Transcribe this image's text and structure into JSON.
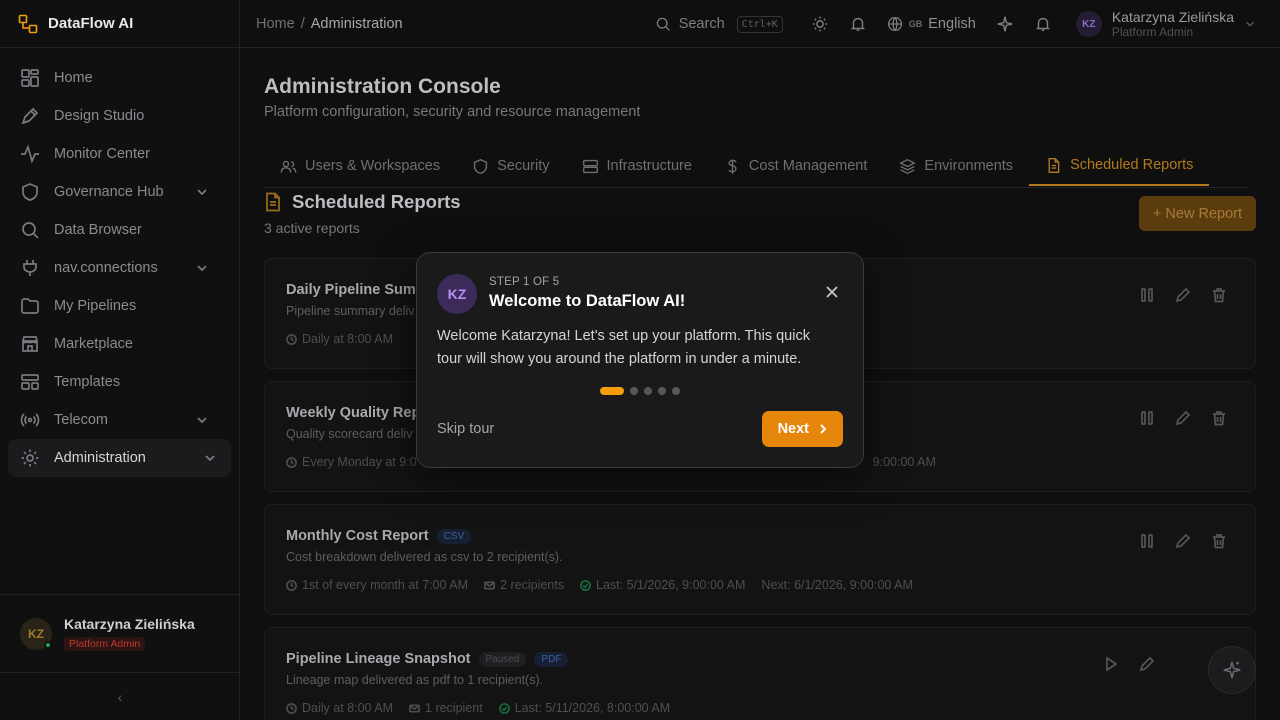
{
  "brand": {
    "name": "DataFlow AI"
  },
  "sidebar": {
    "items": [
      {
        "label": "Home",
        "icon": "grid-icon"
      },
      {
        "label": "Design Studio",
        "icon": "pen-icon"
      },
      {
        "label": "Monitor Center",
        "icon": "activity-icon"
      },
      {
        "label": "Governance Hub",
        "icon": "shield-icon"
      },
      {
        "label": "Data Browser",
        "icon": "search-icon"
      },
      {
        "label": "nav.connections",
        "icon": "plug-icon"
      },
      {
        "label": "My Pipelines",
        "icon": "folder-icon"
      },
      {
        "label": "Marketplace",
        "icon": "store-icon"
      },
      {
        "label": "Templates",
        "icon": "template-icon"
      },
      {
        "label": "Telecom",
        "icon": "radio-icon"
      },
      {
        "label": "Administration",
        "icon": "gear-icon"
      }
    ],
    "user": {
      "name": "Katarzyna Zielińska",
      "role": "Platform Admin",
      "initials": "KZ"
    },
    "collapse_glyph": "‹"
  },
  "topbar": {
    "breadcrumb": {
      "home": "Home",
      "sep": "/",
      "current": "Administration"
    },
    "search_label": "Search",
    "search_shortcut": "Ctrl+K",
    "lang_code": "GB",
    "language": "English",
    "user": {
      "name": "Katarzyna Zielińska",
      "role": "Platform Admin",
      "initials": "KZ"
    }
  },
  "page": {
    "title": "Administration Console",
    "subtitle": "Platform configuration, security and resource management",
    "tabs": [
      {
        "label": "Users & Workspaces"
      },
      {
        "label": "Security"
      },
      {
        "label": "Infrastructure"
      },
      {
        "label": "Cost Management"
      },
      {
        "label": "Environments"
      },
      {
        "label": "Scheduled Reports"
      }
    ]
  },
  "reports": {
    "title": "Scheduled Reports",
    "count_text": "3 active reports",
    "new_button": "+ New Report",
    "cards": [
      {
        "title": "Daily Pipeline Summ",
        "desc": "Pipeline summary deliv",
        "schedule": "Daily at 8:00 AM",
        "recipients": "",
        "last": "",
        "next": "M"
      },
      {
        "title": "Weekly Quality Rep",
        "desc": "Quality scorecard deliv",
        "schedule": "Every Monday at 9:0",
        "recipients": "",
        "last": "",
        "next": "9:00:00 AM"
      },
      {
        "title": "Monthly Cost Report",
        "badge": "CSV",
        "desc": "Cost breakdown delivered as csv to 2 recipient(s).",
        "schedule": "1st of every month at 7:00 AM",
        "recipients": "2 recipients",
        "last": "Last: 5/1/2026, 9:00:00 AM",
        "next": "Next: 6/1/2026, 9:00:00 AM"
      },
      {
        "title": "Pipeline Lineage Snapshot",
        "badge_status": "Paused",
        "badge": "PDF",
        "desc": "Lineage map delivered as pdf to 1 recipient(s).",
        "schedule": "Daily at 8:00 AM",
        "recipients": "1 recipient",
        "last": "Last: 5/11/2026, 8:00:00 AM"
      }
    ]
  },
  "tour": {
    "initials": "KZ",
    "step": "STEP 1 OF 5",
    "title": "Welcome to DataFlow AI!",
    "body": "Welcome Katarzyna! Let's set up your platform. This quick tour will show you around the platform in under a minute.",
    "current_step": 1,
    "total_steps": 5,
    "skip": "Skip tour",
    "next": "Next"
  },
  "colors": {
    "accent": "#e6860a",
    "accent_muted": "#b27a1c",
    "background": "#0f0f10"
  }
}
